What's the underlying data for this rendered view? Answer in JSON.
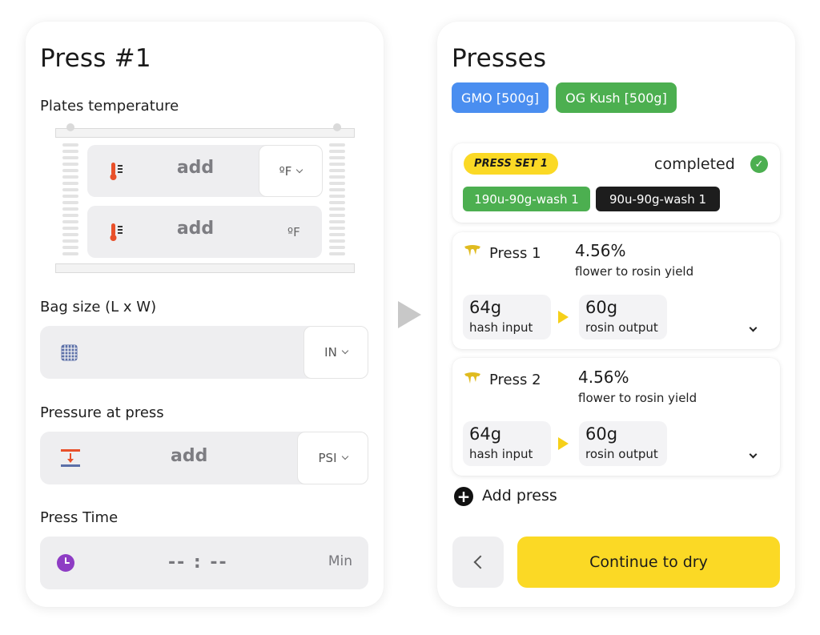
{
  "left_panel": {
    "title": "Press #1",
    "plates_temperature": {
      "label": "Plates temperature",
      "top_plate": {
        "placeholder": "add",
        "unit": "ºF"
      },
      "bottom_plate": {
        "placeholder": "add",
        "unit": "ºF"
      }
    },
    "bag_size": {
      "label": "Bag size (L x W)",
      "unit": "IN"
    },
    "pressure": {
      "label": "Pressure at press",
      "placeholder": "add",
      "unit": "PSI"
    },
    "press_time": {
      "label": "Press Time",
      "value": "-- : --",
      "unit": "Min"
    }
  },
  "right_panel": {
    "title": "Presses",
    "strains": [
      {
        "label": "GMO [500g]",
        "color": "#4a8ef0"
      },
      {
        "label": "OG Kush [500g]",
        "color": "#4caf50"
      }
    ],
    "press_set": {
      "badge": "PRESS SET 1",
      "status": "completed",
      "washes": [
        {
          "label": "190u-90g-wash 1",
          "color": "#4caf50"
        },
        {
          "label": "90u-90g-wash 1",
          "color": "#1d1d1d"
        }
      ]
    },
    "presses": [
      {
        "name": "Press 1",
        "yield": "4.56%",
        "yield_label": "flower to rosin yield",
        "input_value": "64g",
        "input_label": "hash input",
        "output_value": "60g",
        "output_label": "rosin output"
      },
      {
        "name": "Press 2",
        "yield": "4.56%",
        "yield_label": "flower to rosin yield",
        "input_value": "64g",
        "input_label": "hash input",
        "output_value": "60g",
        "output_label": "rosin output"
      }
    ],
    "add_press_label": "Add press",
    "continue_label": "Continue to dry"
  },
  "colors": {
    "accent_yellow": "#fbd925",
    "success_green": "#4caf50",
    "thermo_red": "#e8502a",
    "clock_purple": "#8e3cc4",
    "grid_blue": "#5b6fa8"
  }
}
